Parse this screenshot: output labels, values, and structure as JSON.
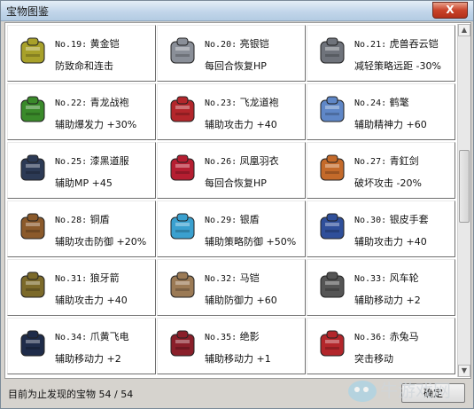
{
  "window": {
    "title": "宝物图鉴",
    "close_label": "X"
  },
  "items": [
    {
      "no": "No.19:",
      "name": "黄金铠",
      "desc": "防致命和连击",
      "icon": "gold-armor-icon",
      "color": "#a8a12a"
    },
    {
      "no": "No.20:",
      "name": "亮银铠",
      "desc": "每回合恢复HP",
      "icon": "silver-armor-icon",
      "color": "#8a8f98"
    },
    {
      "no": "No.21:",
      "name": "虎兽吞云铠",
      "desc": "减轻策略远距 -30%",
      "icon": "tiger-armor-icon",
      "color": "#6f737b"
    },
    {
      "no": "No.22:",
      "name": "青龙战袍",
      "desc": "辅助爆发力 +30%",
      "icon": "dragon-robe-icon",
      "color": "#3a8a2a"
    },
    {
      "no": "No.23:",
      "name": "飞龙道袍",
      "desc": "辅助攻击力 +40",
      "icon": "flying-dragon-robe-icon",
      "color": "#b3262b"
    },
    {
      "no": "No.24:",
      "name": "鹤氅",
      "desc": "辅助精神力 +60",
      "icon": "crane-cloak-icon",
      "color": "#5f87c7"
    },
    {
      "no": "No.25:",
      "name": "漆黑道服",
      "desc": "辅助MP +45",
      "icon": "black-robe-icon",
      "color": "#2c3a55"
    },
    {
      "no": "No.26:",
      "name": "凤凰羽衣",
      "desc": "每回合恢复HP",
      "icon": "phoenix-robe-icon",
      "color": "#b51e31"
    },
    {
      "no": "No.27:",
      "name": "青釭剑",
      "desc": "破坏攻击 -20%",
      "icon": "sword-icon",
      "color": "#c46a2a"
    },
    {
      "no": "No.28:",
      "name": "铜盾",
      "desc": "辅助攻击防御 +20%",
      "icon": "bronze-shield-icon",
      "color": "#8b5a2b"
    },
    {
      "no": "No.29:",
      "name": "银盾",
      "desc": "辅助策略防御 +50%",
      "icon": "silver-shield-icon",
      "color": "#3aa0cf"
    },
    {
      "no": "No.30:",
      "name": "银皮手套",
      "desc": "辅助攻击力 +40",
      "icon": "glove-icon",
      "color": "#2f4f9a"
    },
    {
      "no": "No.31:",
      "name": "狼牙箭",
      "desc": "辅助攻击力 +40",
      "icon": "arrow-icon",
      "color": "#7c6a2a"
    },
    {
      "no": "No.32:",
      "name": "马铠",
      "desc": "辅助防御力 +60",
      "icon": "horse-armor-icon",
      "color": "#9b7a55"
    },
    {
      "no": "No.33:",
      "name": "风车轮",
      "desc": "辅助移动力 +2",
      "icon": "wheel-icon",
      "color": "#555555"
    },
    {
      "no": "No.34:",
      "name": "爪黄飞电",
      "desc": "辅助移动力 +2",
      "icon": "horse-icon",
      "color": "#1f2c4a"
    },
    {
      "no": "No.35:",
      "name": "绝影",
      "desc": "辅助移动力 +1",
      "icon": "shadow-horse-icon",
      "color": "#8a1f2a"
    },
    {
      "no": "No.36:",
      "name": "赤兔马",
      "desc": "突击移动",
      "icon": "red-hare-icon",
      "color": "#b3262b"
    }
  ],
  "footer": {
    "status": "目前为止发现的宝物 54 / 54",
    "ok_label": "确定"
  },
  "watermark": {
    "text": "牛游戏网"
  }
}
